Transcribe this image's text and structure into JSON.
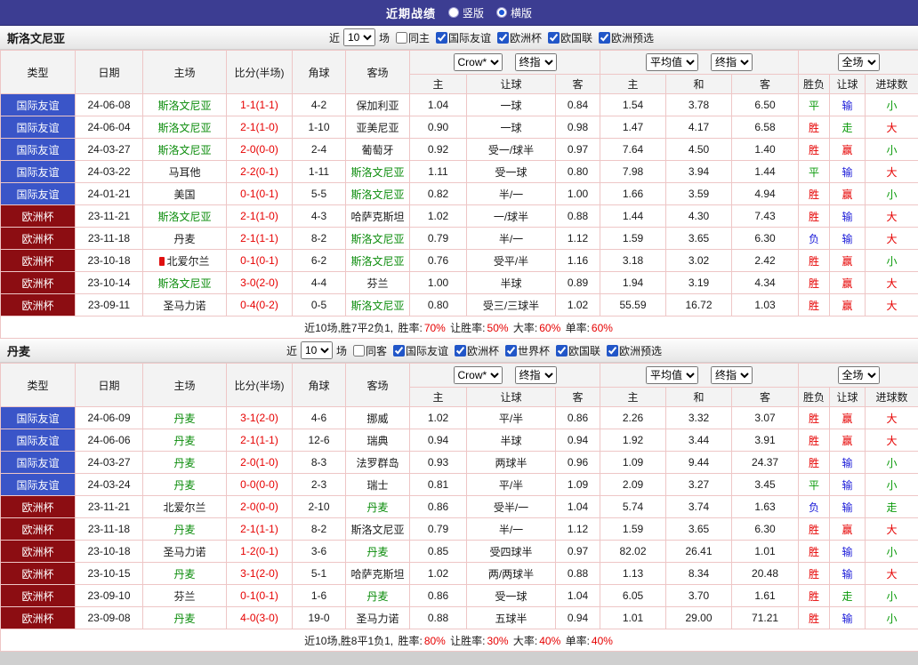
{
  "topbar": {
    "title": "近期战绩",
    "options": [
      {
        "label": "竖版",
        "selected": false
      },
      {
        "label": "横版",
        "selected": true
      }
    ]
  },
  "labels": {
    "near": "近",
    "games_suffix": "场"
  },
  "table": {
    "main_columns": [
      "类型",
      "日期",
      "主场",
      "比分(半场)",
      "角球",
      "客场"
    ],
    "main_keys": [
      "type",
      "date",
      "home",
      "score",
      "corner",
      "away"
    ],
    "odds_group": {
      "selects": [
        "Crow*",
        "终指"
      ],
      "sub": [
        "主",
        "让球",
        "客"
      ]
    },
    "avg_group": {
      "selects": [
        "平均值",
        "终指"
      ],
      "sub": [
        "主",
        "和",
        "客"
      ]
    },
    "full_group": {
      "selects": [
        "全场"
      ],
      "sub": [
        "胜负",
        "让球",
        "进球数"
      ]
    }
  },
  "colors": {
    "topbar_bg": "#3c3d92",
    "badge_friendly_blue": "#3a55c8",
    "badge_eurocup_maroon": "#8c0d12",
    "focus_team_green": "#0b8c0b",
    "score_red": "#e60000",
    "win_red": "#e60000",
    "draw_green": "#0b9a0b",
    "loss_blue": "#1a1ad8",
    "grid_line": "#eec6c6"
  },
  "sections": [
    {
      "team": "斯洛文尼亚",
      "filters": {
        "games": "10",
        "same": {
          "label": "同主",
          "checked": false
        },
        "competitions": [
          {
            "label": "国际友谊",
            "checked": true
          },
          {
            "label": "欧洲杯",
            "checked": true
          },
          {
            "label": "欧国联",
            "checked": true
          },
          {
            "label": "欧洲预选",
            "checked": true
          }
        ]
      },
      "rows": [
        {
          "type": "国际友谊",
          "date": "24-06-08",
          "home": "斯洛文尼亚",
          "score": "1-1(1-1)",
          "corner": "4-2",
          "away": "保加利亚",
          "odds": [
            "1.04",
            "一球",
            "0.84"
          ],
          "avg": [
            "1.54",
            "3.78",
            "6.50"
          ],
          "results": [
            "平",
            "输",
            "小"
          ]
        },
        {
          "type": "国际友谊",
          "date": "24-06-04",
          "home": "斯洛文尼亚",
          "score": "2-1(1-0)",
          "corner": "1-10",
          "away": "亚美尼亚",
          "odds": [
            "0.90",
            "一球",
            "0.98"
          ],
          "avg": [
            "1.47",
            "4.17",
            "6.58"
          ],
          "results": [
            "胜",
            "走",
            "大"
          ]
        },
        {
          "type": "国际友谊",
          "date": "24-03-27",
          "home": "斯洛文尼亚",
          "score": "2-0(0-0)",
          "corner": "2-4",
          "away": "葡萄牙",
          "odds": [
            "0.92",
            "受一/球半",
            "0.97"
          ],
          "avg": [
            "7.64",
            "4.50",
            "1.40"
          ],
          "results": [
            "胜",
            "赢",
            "小"
          ]
        },
        {
          "type": "国际友谊",
          "date": "24-03-22",
          "home": "马耳他",
          "score": "2-2(0-1)",
          "corner": "1-11",
          "away": "斯洛文尼亚",
          "odds": [
            "1.11",
            "受一球",
            "0.80"
          ],
          "avg": [
            "7.98",
            "3.94",
            "1.44"
          ],
          "results": [
            "平",
            "输",
            "大"
          ]
        },
        {
          "type": "国际友谊",
          "date": "24-01-21",
          "home": "美国",
          "score": "0-1(0-1)",
          "corner": "5-5",
          "away": "斯洛文尼亚",
          "odds": [
            "0.82",
            "半/一",
            "1.00"
          ],
          "avg": [
            "1.66",
            "3.59",
            "4.94"
          ],
          "results": [
            "胜",
            "赢",
            "小"
          ]
        },
        {
          "type": "欧洲杯",
          "date": "23-11-21",
          "home": "斯洛文尼亚",
          "score": "2-1(1-0)",
          "corner": "4-3",
          "away": "哈萨克斯坦",
          "odds": [
            "1.02",
            "一/球半",
            "0.88"
          ],
          "avg": [
            "1.44",
            "4.30",
            "7.43"
          ],
          "results": [
            "胜",
            "输",
            "大"
          ]
        },
        {
          "type": "欧洲杯",
          "date": "23-11-18",
          "home": "丹麦",
          "score": "2-1(1-1)",
          "corner": "8-2",
          "away": "斯洛文尼亚",
          "odds": [
            "0.79",
            "半/一",
            "1.12"
          ],
          "avg": [
            "1.59",
            "3.65",
            "6.30"
          ],
          "results": [
            "负",
            "输",
            "大"
          ]
        },
        {
          "type": "欧洲杯",
          "date": "23-10-18",
          "home": "北爱尔兰",
          "home_icon": true,
          "score": "0-1(0-1)",
          "corner": "6-2",
          "away": "斯洛文尼亚",
          "odds": [
            "0.76",
            "受平/半",
            "1.16"
          ],
          "avg": [
            "3.18",
            "3.02",
            "2.42"
          ],
          "results": [
            "胜",
            "赢",
            "小"
          ]
        },
        {
          "type": "欧洲杯",
          "date": "23-10-14",
          "home": "斯洛文尼亚",
          "score": "3-0(2-0)",
          "corner": "4-4",
          "away": "芬兰",
          "odds": [
            "1.00",
            "半球",
            "0.89"
          ],
          "avg": [
            "1.94",
            "3.19",
            "4.34"
          ],
          "results": [
            "胜",
            "赢",
            "大"
          ]
        },
        {
          "type": "欧洲杯",
          "date": "23-09-11",
          "home": "圣马力诺",
          "score": "0-4(0-2)",
          "corner": "0-5",
          "away": "斯洛文尼亚",
          "odds": [
            "0.80",
            "受三/三球半",
            "1.02"
          ],
          "avg": [
            "55.59",
            "16.72",
            "1.03"
          ],
          "results": [
            "胜",
            "赢",
            "大"
          ]
        }
      ],
      "summary": {
        "prefix": "近10场,胜7平2负1,",
        "stats": [
          [
            "胜率:",
            "70%"
          ],
          [
            "让胜率:",
            "50%"
          ],
          [
            "大率:",
            "60%"
          ],
          [
            "单率:",
            "60%"
          ]
        ]
      }
    },
    {
      "team": "丹麦",
      "filters": {
        "games": "10",
        "same": {
          "label": "同客",
          "checked": false
        },
        "competitions": [
          {
            "label": "国际友谊",
            "checked": true
          },
          {
            "label": "欧洲杯",
            "checked": true
          },
          {
            "label": "世界杯",
            "checked": true
          },
          {
            "label": "欧国联",
            "checked": true
          },
          {
            "label": "欧洲预选",
            "checked": true
          }
        ]
      },
      "rows": [
        {
          "type": "国际友谊",
          "date": "24-06-09",
          "home": "丹麦",
          "score": "3-1(2-0)",
          "corner": "4-6",
          "away": "挪威",
          "odds": [
            "1.02",
            "平/半",
            "0.86"
          ],
          "avg": [
            "2.26",
            "3.32",
            "3.07"
          ],
          "results": [
            "胜",
            "赢",
            "大"
          ]
        },
        {
          "type": "国际友谊",
          "date": "24-06-06",
          "home": "丹麦",
          "score": "2-1(1-1)",
          "corner": "12-6",
          "away": "瑞典",
          "odds": [
            "0.94",
            "半球",
            "0.94"
          ],
          "avg": [
            "1.92",
            "3.44",
            "3.91"
          ],
          "results": [
            "胜",
            "赢",
            "大"
          ]
        },
        {
          "type": "国际友谊",
          "date": "24-03-27",
          "home": "丹麦",
          "score": "2-0(1-0)",
          "corner": "8-3",
          "away": "法罗群岛",
          "odds": [
            "0.93",
            "两球半",
            "0.96"
          ],
          "avg": [
            "1.09",
            "9.44",
            "24.37"
          ],
          "results": [
            "胜",
            "输",
            "小"
          ]
        },
        {
          "type": "国际友谊",
          "date": "24-03-24",
          "home": "丹麦",
          "score": "0-0(0-0)",
          "corner": "2-3",
          "away": "瑞士",
          "odds": [
            "0.81",
            "平/半",
            "1.09"
          ],
          "avg": [
            "2.09",
            "3.27",
            "3.45"
          ],
          "results": [
            "平",
            "输",
            "小"
          ]
        },
        {
          "type": "欧洲杯",
          "date": "23-11-21",
          "home": "北爱尔兰",
          "score": "2-0(0-0)",
          "corner": "2-10",
          "away": "丹麦",
          "odds": [
            "0.86",
            "受半/一",
            "1.04"
          ],
          "avg": [
            "5.74",
            "3.74",
            "1.63"
          ],
          "results": [
            "负",
            "输",
            "走"
          ]
        },
        {
          "type": "欧洲杯",
          "date": "23-11-18",
          "home": "丹麦",
          "score": "2-1(1-1)",
          "corner": "8-2",
          "away": "斯洛文尼亚",
          "odds": [
            "0.79",
            "半/一",
            "1.12"
          ],
          "avg": [
            "1.59",
            "3.65",
            "6.30"
          ],
          "results": [
            "胜",
            "赢",
            "大"
          ]
        },
        {
          "type": "欧洲杯",
          "date": "23-10-18",
          "home": "圣马力诺",
          "score": "1-2(0-1)",
          "corner": "3-6",
          "away": "丹麦",
          "odds": [
            "0.85",
            "受四球半",
            "0.97"
          ],
          "avg": [
            "82.02",
            "26.41",
            "1.01"
          ],
          "results": [
            "胜",
            "输",
            "小"
          ]
        },
        {
          "type": "欧洲杯",
          "date": "23-10-15",
          "home": "丹麦",
          "score": "3-1(2-0)",
          "corner": "5-1",
          "away": "哈萨克斯坦",
          "odds": [
            "1.02",
            "两/两球半",
            "0.88"
          ],
          "avg": [
            "1.13",
            "8.34",
            "20.48"
          ],
          "results": [
            "胜",
            "输",
            "大"
          ]
        },
        {
          "type": "欧洲杯",
          "date": "23-09-10",
          "home": "芬兰",
          "score": "0-1(0-1)",
          "corner": "1-6",
          "away": "丹麦",
          "odds": [
            "0.86",
            "受一球",
            "1.04"
          ],
          "avg": [
            "6.05",
            "3.70",
            "1.61"
          ],
          "results": [
            "胜",
            "走",
            "小"
          ]
        },
        {
          "type": "欧洲杯",
          "date": "23-09-08",
          "home": "丹麦",
          "score": "4-0(3-0)",
          "corner": "19-0",
          "away": "圣马力诺",
          "odds": [
            "0.88",
            "五球半",
            "0.94"
          ],
          "avg": [
            "1.01",
            "29.00",
            "71.21"
          ],
          "results": [
            "胜",
            "输",
            "小"
          ]
        }
      ],
      "summary": {
        "prefix": "近10场,胜8平1负1,",
        "stats": [
          [
            "胜率:",
            "80%"
          ],
          [
            "让胜率:",
            "30%"
          ],
          [
            "大率:",
            "40%"
          ],
          [
            "单率:",
            "40%"
          ]
        ]
      }
    }
  ]
}
